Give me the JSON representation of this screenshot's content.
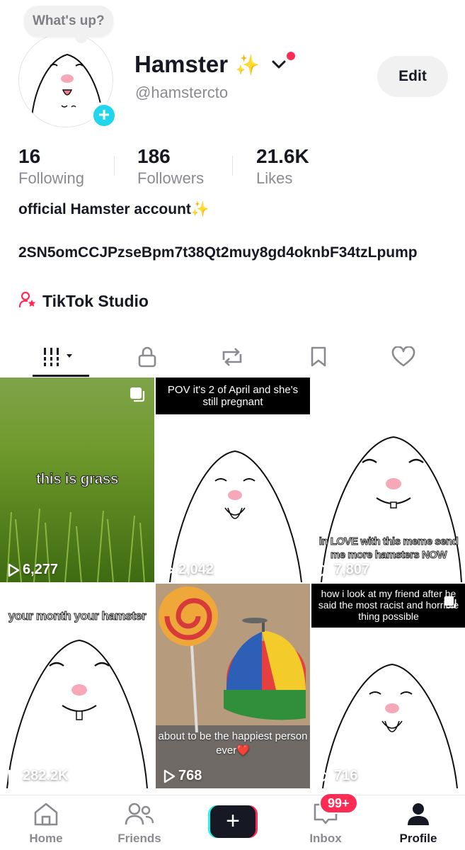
{
  "profile": {
    "note": "What's up?",
    "display_name": "Hamster",
    "name_emoji": "✨",
    "handle": "@hamstercto",
    "edit_label": "Edit",
    "bio": "official Hamster account✨",
    "wallet_line": "2SN5omCCJPzseBpm7t38Qt2muy8gd4oknbF34tzLpump",
    "studio_label": "TikTok Studio"
  },
  "stats": [
    {
      "value": "16",
      "label": "Following"
    },
    {
      "value": "186",
      "label": "Followers"
    },
    {
      "value": "21.6K",
      "label": "Likes"
    }
  ],
  "tabs": [
    "videos-tab",
    "private-tab",
    "reposts-tab",
    "favorites-tab",
    "liked-tab"
  ],
  "videos": [
    {
      "caption": "this is grass",
      "views": "6,277"
    },
    {
      "caption": "POV it's 2 of April and she's still pregnant",
      "views": "2,042"
    },
    {
      "caption": "in LOVE with this meme send me more hamsters NOW",
      "views": "7,807"
    },
    {
      "caption": "your month your hamster",
      "views": "282.2K"
    },
    {
      "caption": "about to be the happiest person ever❤️",
      "views": "768"
    },
    {
      "caption": "how i look at my friend after he said the most racist and horrible thing possible",
      "views": "716"
    }
  ],
  "bottom_nav": {
    "home": "Home",
    "friends": "Friends",
    "inbox": "Inbox",
    "inbox_badge": "99+",
    "profile": "Profile"
  },
  "colors": {
    "accent_red": "#fe2c55",
    "accent_cyan": "#25f4ee",
    "plus_blue": "#20d5ec",
    "text_primary": "#161823",
    "text_secondary": "#8a8b91"
  }
}
